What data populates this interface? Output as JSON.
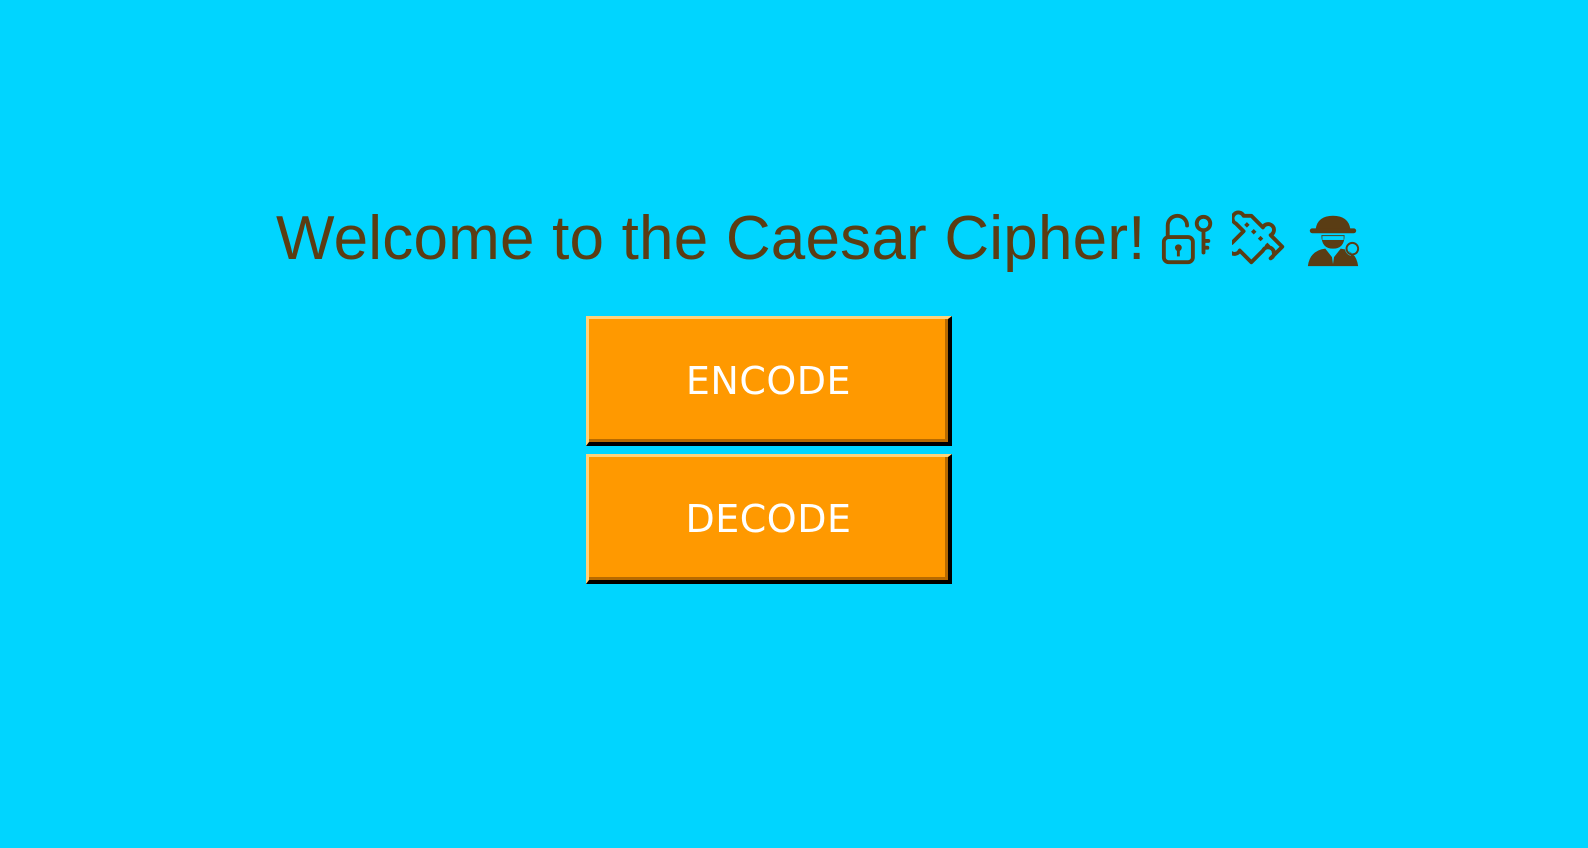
{
  "header": {
    "title": "Welcome to the Caesar Cipher!",
    "icons": [
      "unlock-key-icon",
      "puzzle-piece-icon",
      "detective-icon"
    ]
  },
  "buttons": {
    "encode_label": "ENCODE",
    "decode_label": "DECODE"
  },
  "colors": {
    "background": "#00d5ff",
    "title_text": "#5a3d14",
    "button_fill": "#ff9900",
    "button_text": "#ffffff"
  }
}
